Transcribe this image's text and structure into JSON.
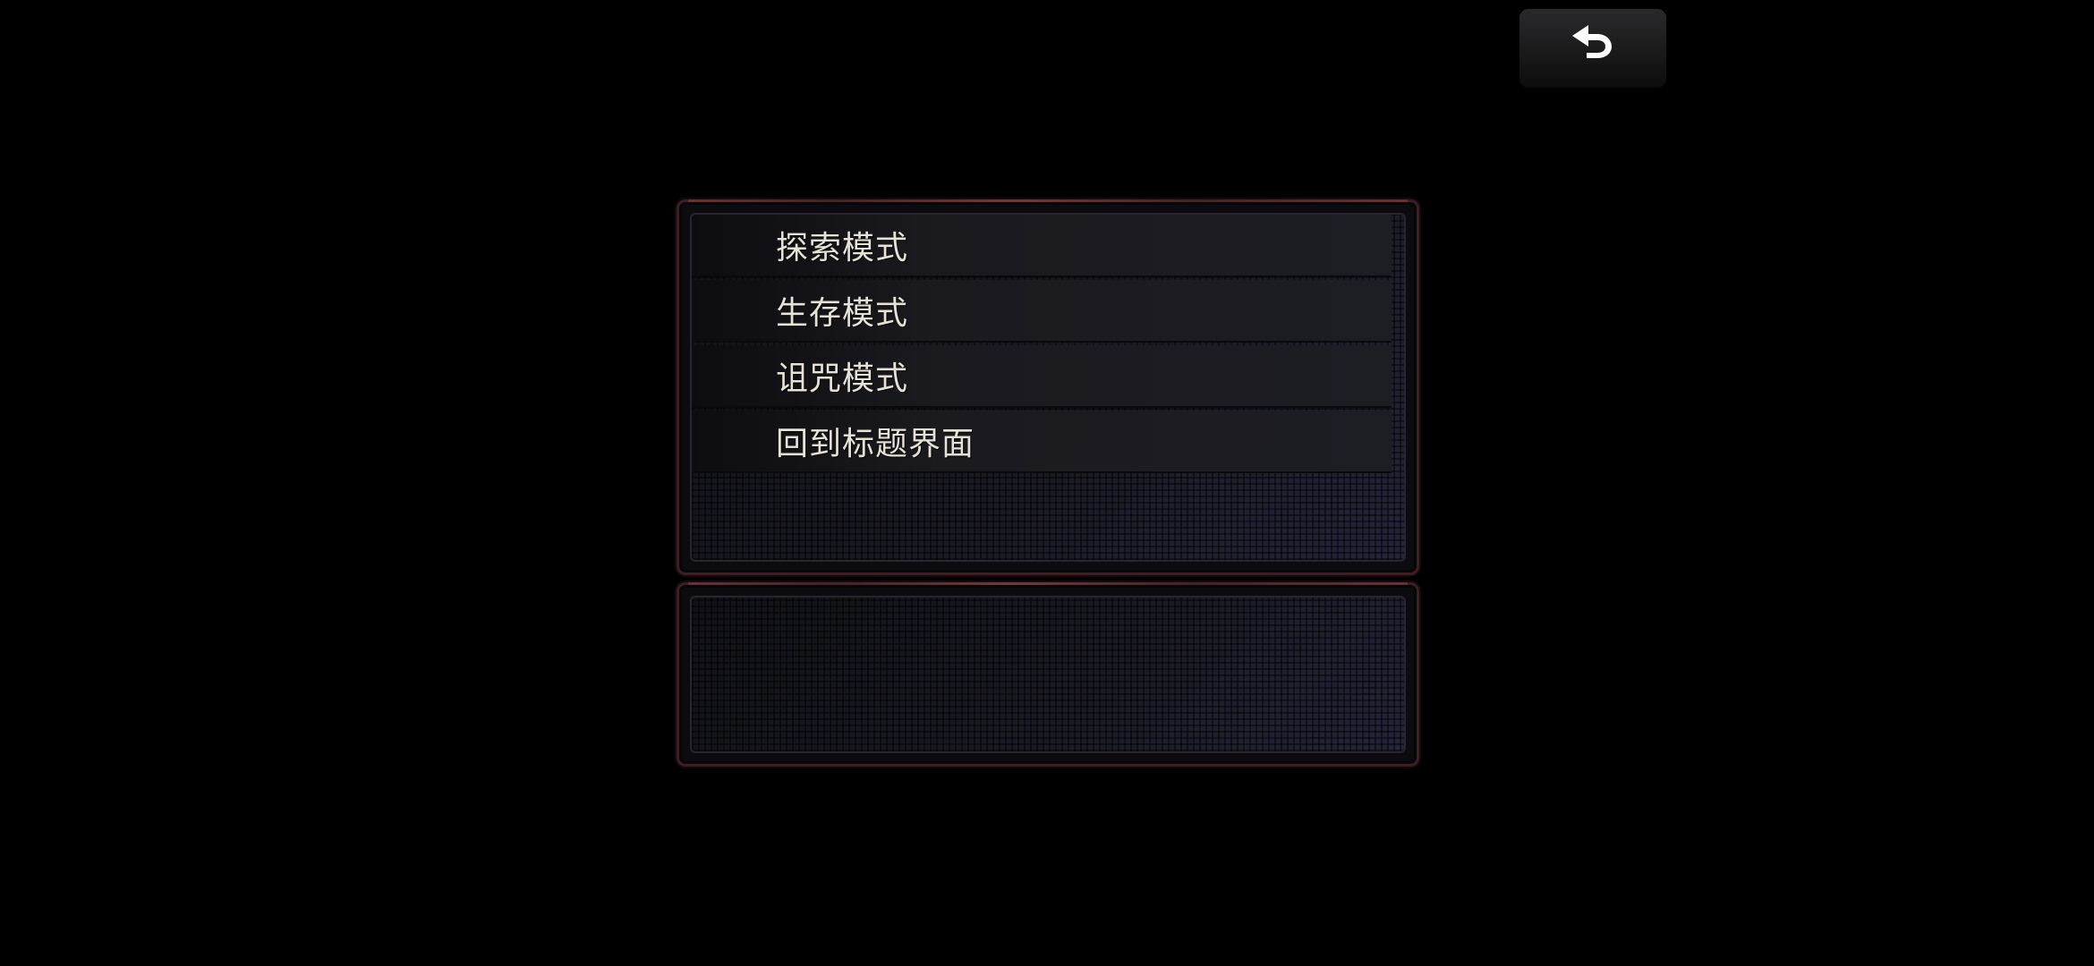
{
  "header": {
    "back_icon": "undo-arrow-icon"
  },
  "menu": {
    "items": [
      {
        "label": "探索模式"
      },
      {
        "label": "生存模式"
      },
      {
        "label": "诅咒模式"
      },
      {
        "label": "回到标题界面"
      }
    ]
  },
  "info_panel": {
    "text": ""
  },
  "colors": {
    "background": "#000000",
    "panel_border": "#3c1f24",
    "accent_red": "#8a2f30",
    "text": "#e6e3d6"
  }
}
